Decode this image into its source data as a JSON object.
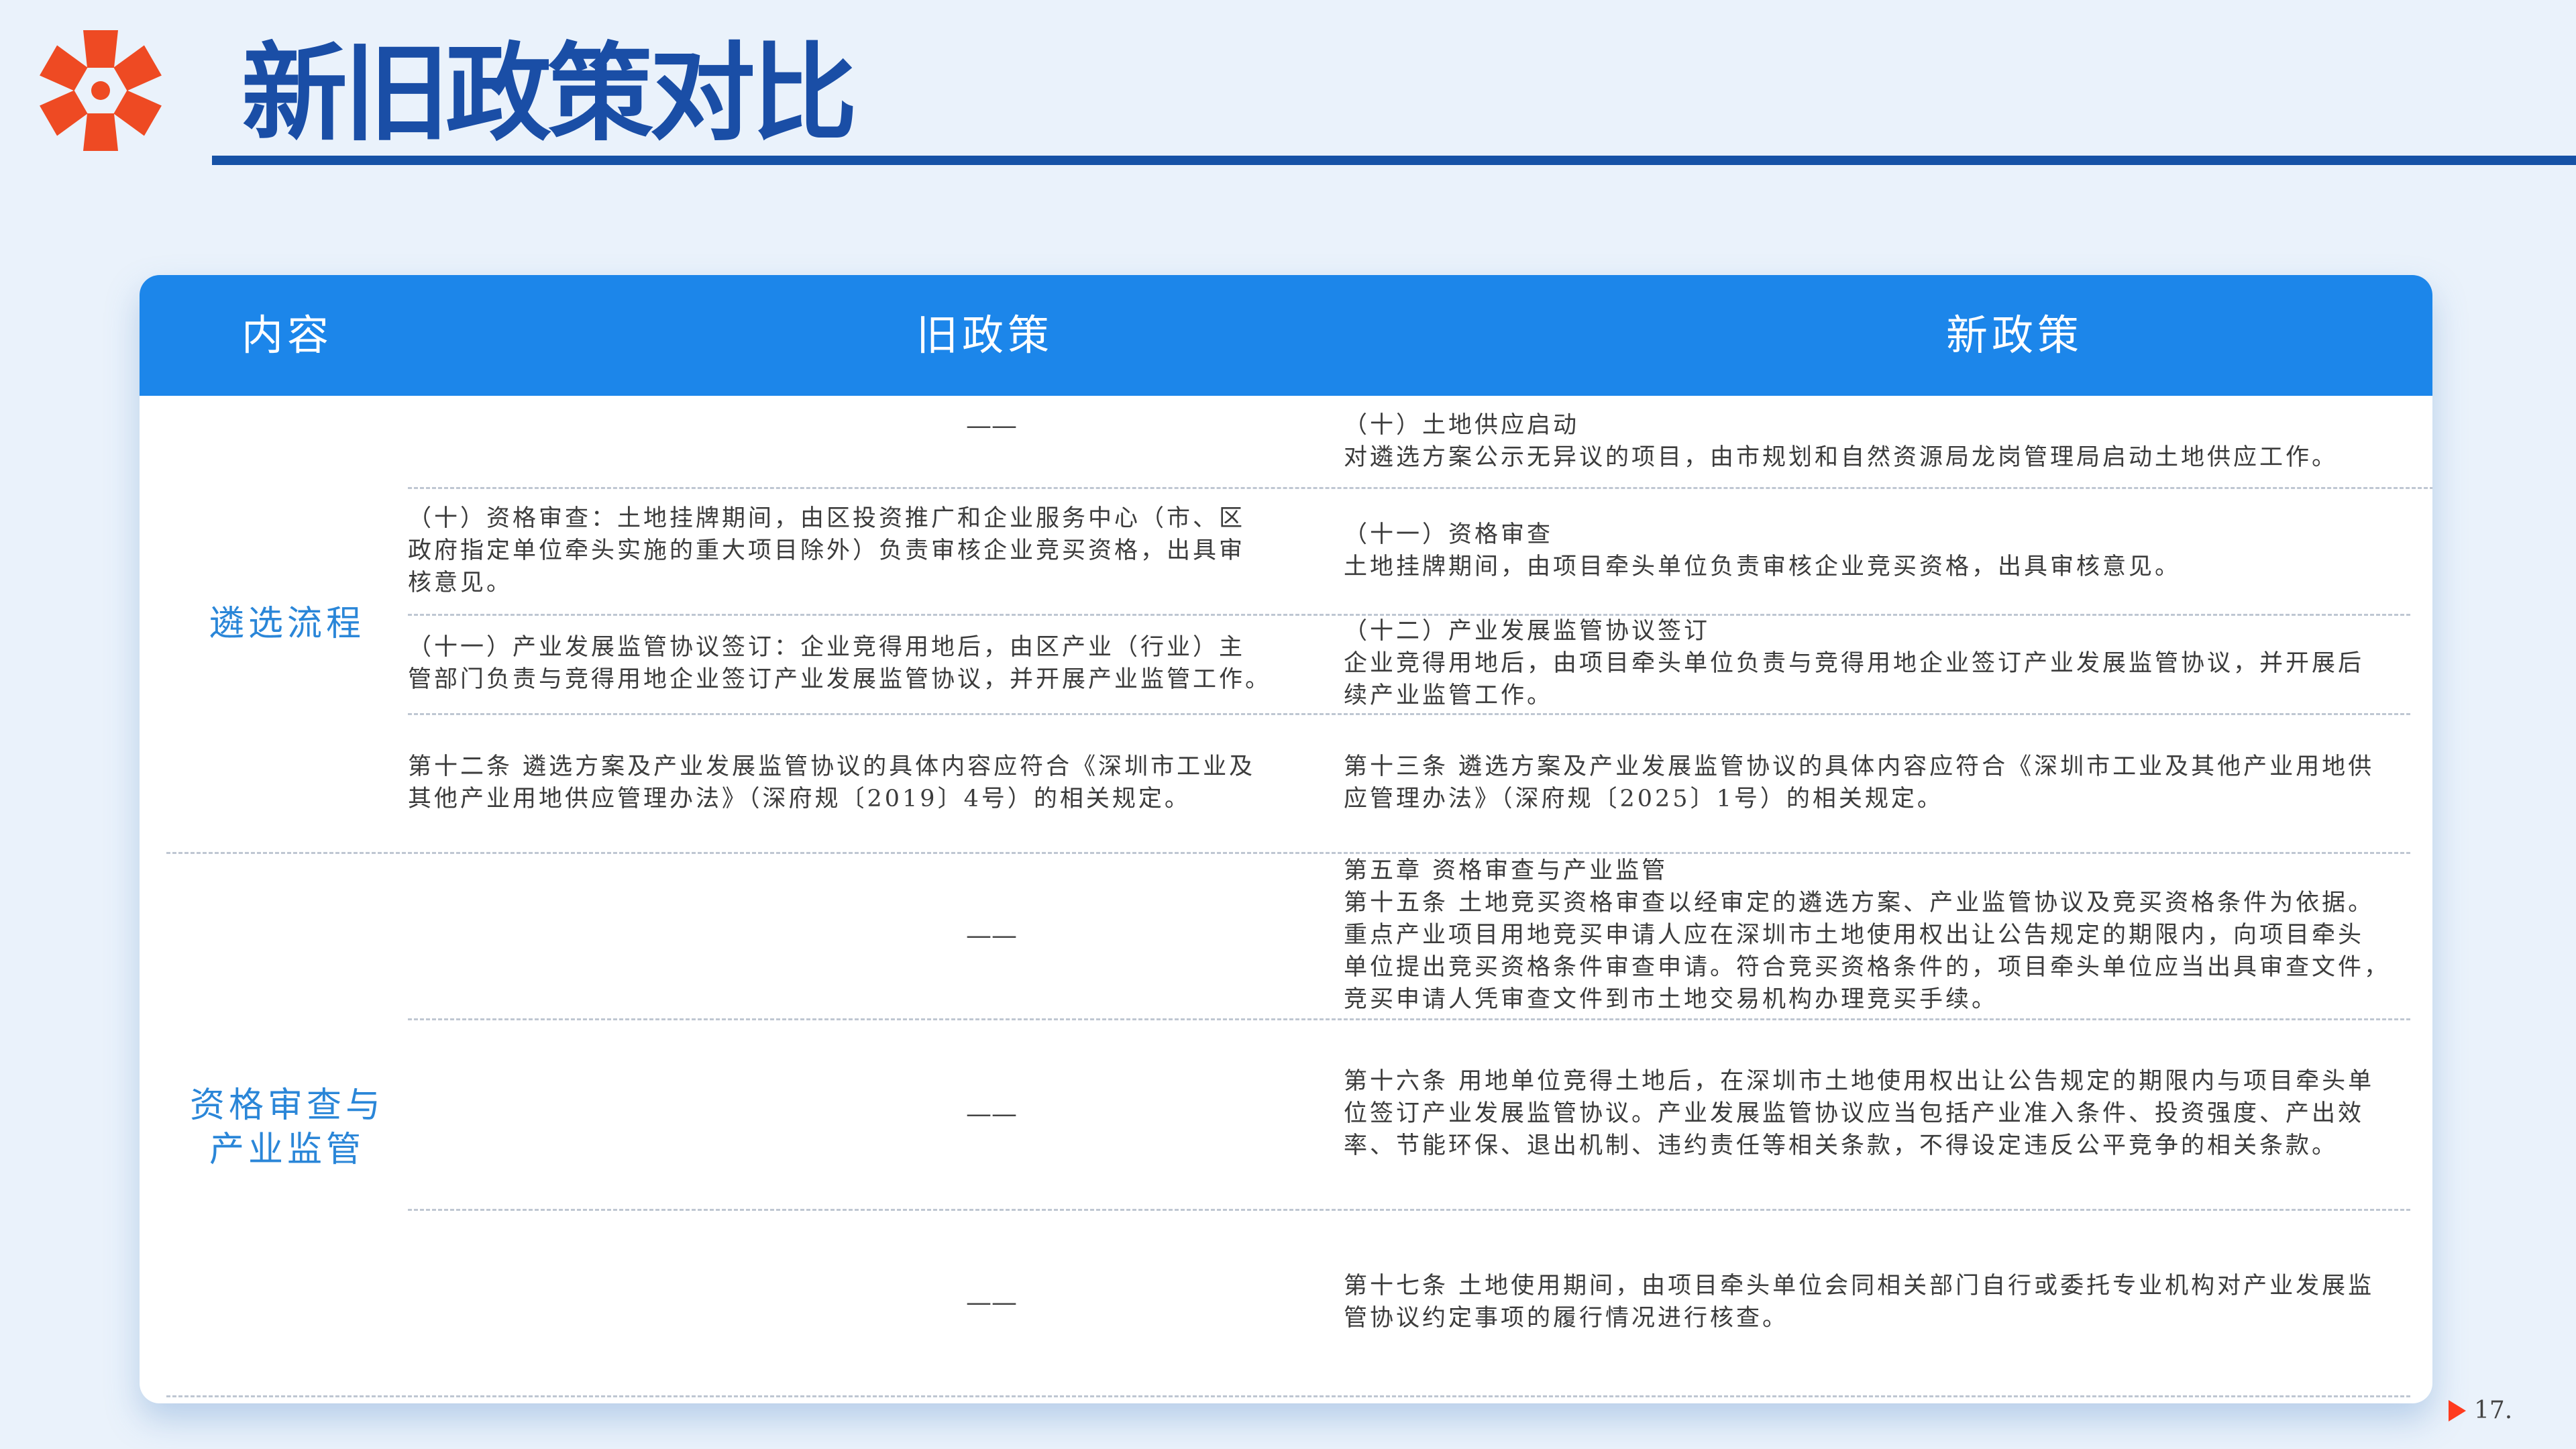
{
  "header": {
    "title": "新旧政策对比"
  },
  "table": {
    "headers": {
      "content": "内容",
      "old": "旧政策",
      "new": "新政策"
    },
    "sections": [
      {
        "category": "遴选流程",
        "rows": [
          {
            "old": [
              "——"
            ],
            "new": [
              "（十）土地供应启动",
              "对遴选方案公示无异议的项目，由市规划和自然资源局龙岗管理局启动土地供应工作。"
            ]
          },
          {
            "old": [
              "（十）资格审查：土地挂牌期间，由区投资推广和企业服务中心（市、区",
              "政府指定单位牵头实施的重大项目除外）负责审核企业竞买资格，出具审",
              "核意见。"
            ],
            "new": [
              "（十一）资格审查",
              "土地挂牌期间，由项目牵头单位负责审核企业竞买资格，出具审核意见。"
            ]
          },
          {
            "old": [
              "（十一）产业发展监管协议签订：企业竞得用地后，由区产业（行业）主",
              "管部门负责与竞得用地企业签订产业发展监管协议，并开展产业监管工作。"
            ],
            "new": [
              "（十二）产业发展监管协议签订",
              "企业竞得用地后，由项目牵头单位负责与竞得用地企业签订产业发展监管协议，并开展后",
              "续产业监管工作。"
            ]
          },
          {
            "old": [
              "第十二条 遴选方案及产业发展监管协议的具体内容应符合《深圳市工业及",
              "其他产业用地供应管理办法》（深府规〔2019〕4号）的相关规定。"
            ],
            "new": [
              "第十三条 遴选方案及产业发展监管协议的具体内容应符合《深圳市工业及其他产业用地供",
              "应管理办法》（深府规〔2025〕1号）的相关规定。"
            ]
          }
        ]
      },
      {
        "category": "资格审查与\n产业监管",
        "rows": [
          {
            "old": [
              "——"
            ],
            "new": [
              "第五章 资格审查与产业监管",
              "第十五条 土地竞买资格审查以经审定的遴选方案、产业监管协议及竞买资格条件为依据。",
              "重点产业项目用地竞买申请人应在深圳市土地使用权出让公告规定的期限内，向项目牵头",
              "单位提出竞买资格条件审查申请。符合竞买资格条件的，项目牵头单位应当出具审查文件，",
              "竞买申请人凭审查文件到市土地交易机构办理竞买手续。"
            ]
          },
          {
            "old": [
              "——"
            ],
            "new": [
              "第十六条 用地单位竞得土地后，在深圳市土地使用权出让公告规定的期限内与项目牵头单",
              "位签订产业发展监管协议。产业发展监管协议应当包括产业准入条件、投资强度、产出效",
              "率、节能环保、退出机制、违约责任等相关条款，不得设定违反公平竞争的相关条款。"
            ]
          },
          {
            "old": [
              "——"
            ],
            "new": [
              "第十七条 土地使用期间，由项目牵头单位会同相关部门自行或委托专业机构对产业发展监",
              "管协议约定事项的履行情况进行核查。"
            ]
          }
        ]
      }
    ]
  },
  "footer": {
    "page_number": "17."
  },
  "colors": {
    "accent": "#1c86ea",
    "title": "#1a4ea6",
    "logo": "#ee4a23",
    "category": "#2a86d8"
  }
}
